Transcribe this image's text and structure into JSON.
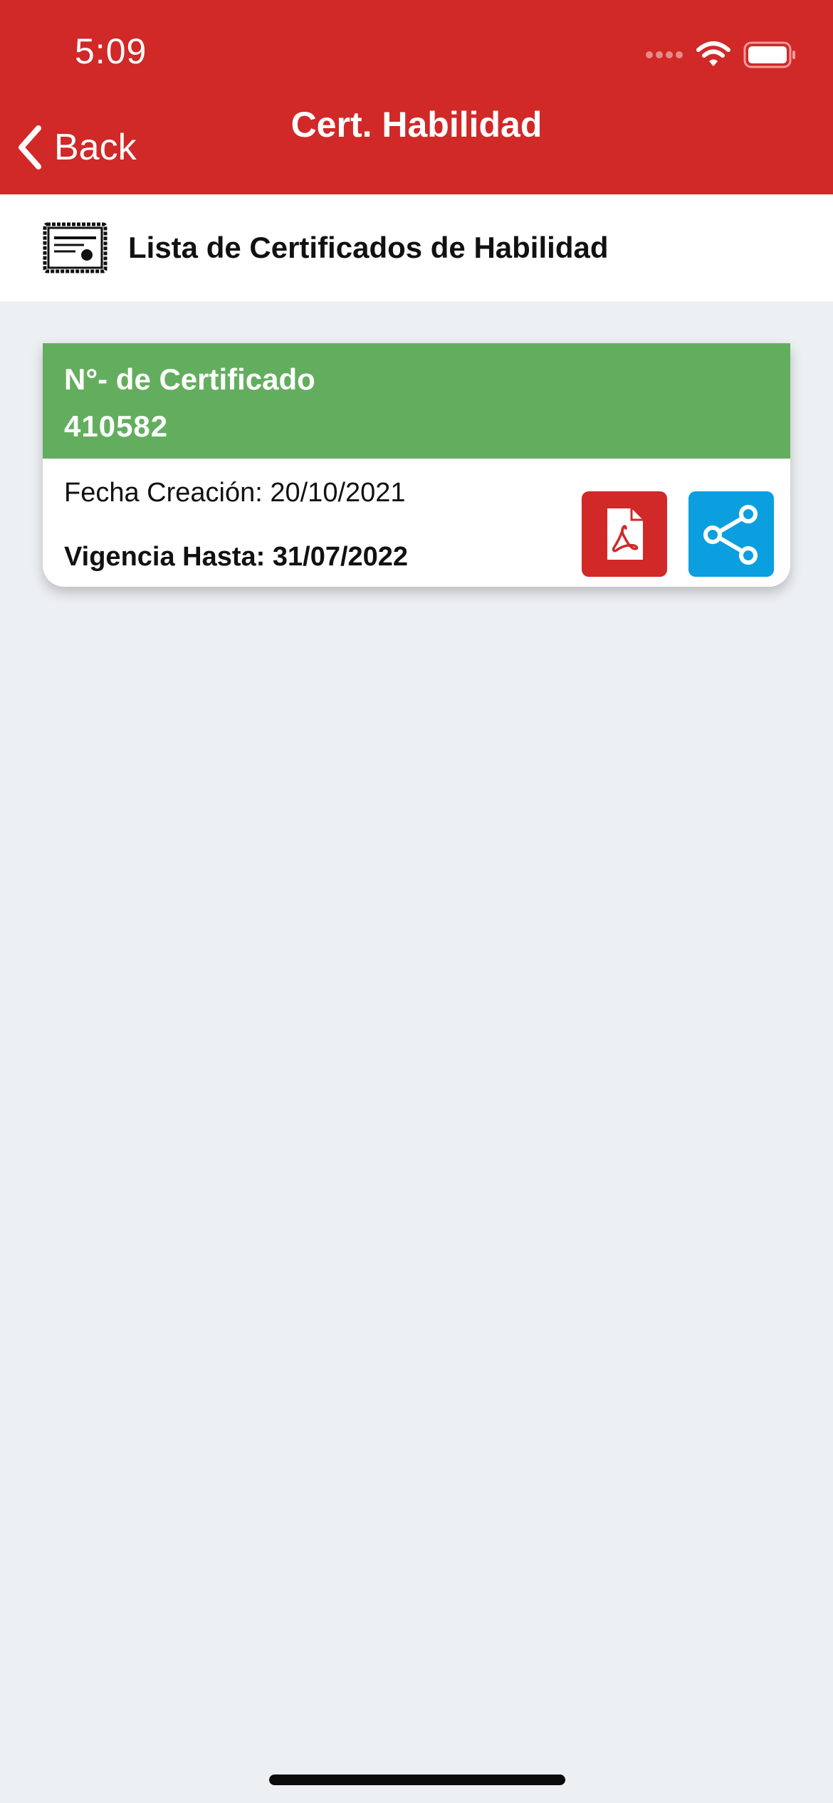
{
  "status_bar": {
    "time": "5:09",
    "signal_icon": "signal-dots-icon",
    "wifi_icon": "wifi-icon",
    "battery_icon": "battery-icon"
  },
  "nav": {
    "back_label": "Back",
    "title": "Cert. Habilidad",
    "back_icon": "chevron-left-icon"
  },
  "section": {
    "icon": "certificate-icon",
    "title": "Lista de Certificados de Habilidad"
  },
  "certificates": [
    {
      "label": "N°- de Certificado",
      "number": "410582",
      "created": "Fecha Creación: 20/10/2021",
      "valid_until": "Vigencia Hasta: 31/07/2022",
      "pdf_icon": "pdf-icon",
      "share_icon": "share-icon"
    }
  ],
  "colors": {
    "header_red": "#d12828",
    "card_green": "#63ae5e",
    "share_blue": "#0b9fe0",
    "background": "#edf0f3"
  }
}
